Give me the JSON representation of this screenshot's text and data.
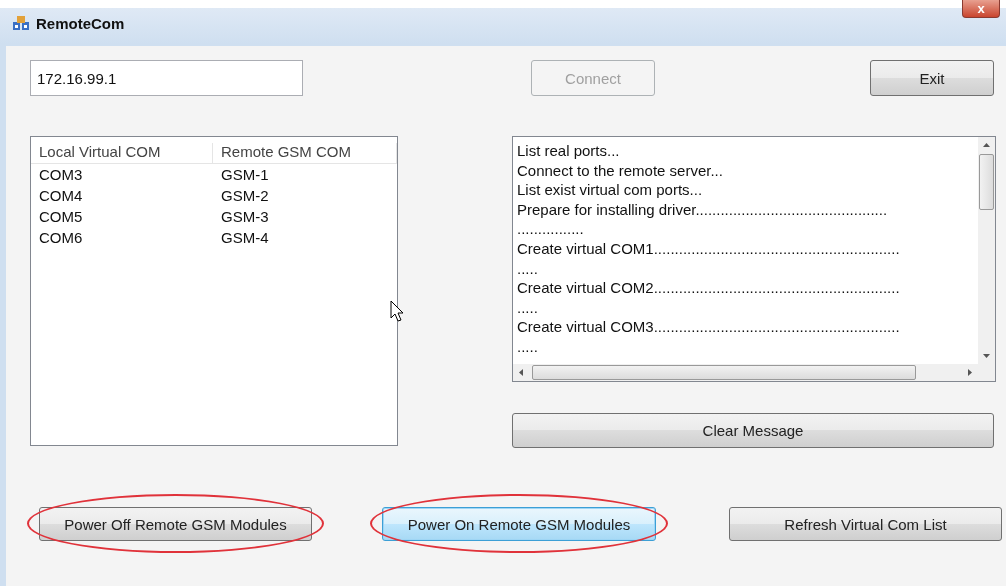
{
  "window": {
    "title": "RemoteCom",
    "close_symbol": "x"
  },
  "address": {
    "value": "172.16.99.1"
  },
  "top_buttons": [
    {
      "label": "Connect",
      "disabled": true
    },
    {
      "label": "Exit",
      "disabled": false
    }
  ],
  "port_table": {
    "columns": [
      "Local Virtual COM",
      "Remote GSM COM"
    ],
    "rows": [
      [
        "COM3",
        "GSM-1"
      ],
      [
        "COM4",
        "GSM-2"
      ],
      [
        "COM5",
        "GSM-3"
      ],
      [
        "COM6",
        "GSM-4"
      ]
    ]
  },
  "log": {
    "lines": [
      "List real ports...",
      "Connect to the remote server...",
      "List exist virtual com ports...",
      "Prepare for installing driver..............................................",
      "................",
      "Create virtual COM1...........................................................",
      ".....",
      "Create virtual COM2...........................................................",
      ".....",
      "Create virtual COM3...........................................................",
      "....."
    ]
  },
  "clear_button": {
    "label": "Clear Message"
  },
  "bottom_buttons": [
    {
      "label": "Power Off Remote GSM Modules",
      "focused": false,
      "circled": true
    },
    {
      "label": "Power On Remote GSM Modules",
      "focused": true,
      "circled": true
    },
    {
      "label": "Refresh Virtual Com List",
      "focused": false,
      "circled": false
    }
  ]
}
